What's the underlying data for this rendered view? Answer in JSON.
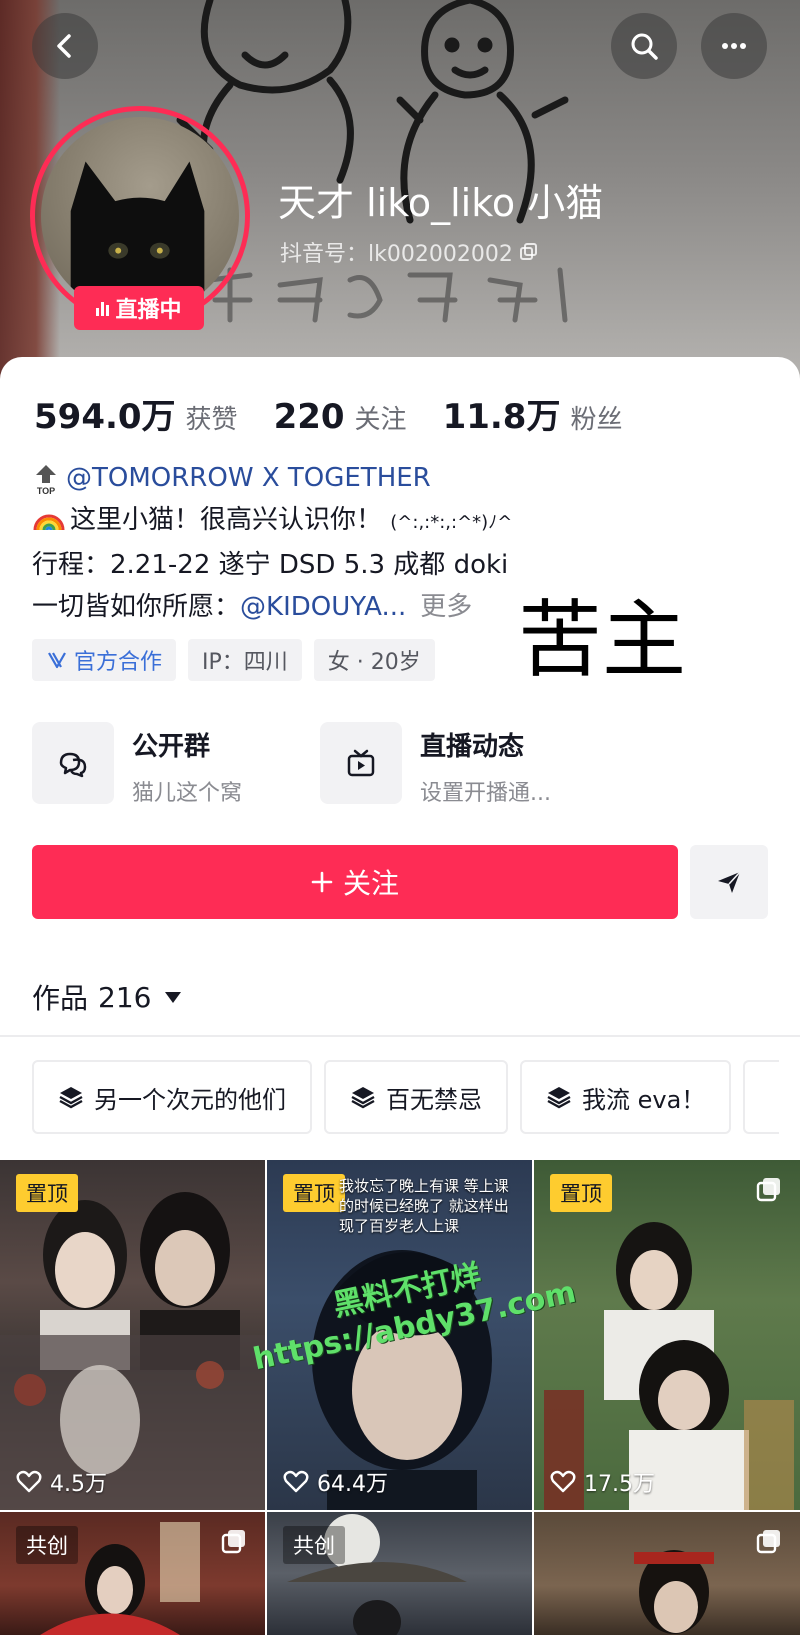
{
  "profile": {
    "nickname": "天才 liko_liko 小猫",
    "douyin_id": "抖音号：lk002002002",
    "live_badge": "直播中"
  },
  "stats": [
    {
      "value": "594.0万",
      "label": "获赞"
    },
    {
      "value": "220",
      "label": "关注"
    },
    {
      "value": "11.8万",
      "label": "粉丝"
    }
  ],
  "bio": {
    "top_link": "@TOMORROW X TOGETHER",
    "line2": "这里小猫！很高兴认识你！",
    "line2_kaomoji": "(^:,:*:,:^*)ﾉ^",
    "line3": "行程：2.21-22 遂宁 DSD 5.3 成都 doki",
    "line4_prefix": "一切皆如你所愿：",
    "line4_link": "@KIDOUYA...",
    "more": "更多"
  },
  "overlay_text": "苦主",
  "tags": [
    {
      "label": "官方合作",
      "icon": "official-icon"
    },
    {
      "label": "IP：四川"
    },
    {
      "label": "女 · 20岁"
    }
  ],
  "entries": [
    {
      "title": "公开群",
      "sub": "猫儿这个窝",
      "icon": "chat-group-icon"
    },
    {
      "title": "直播动态",
      "sub": "设置开播通...",
      "icon": "tv-icon"
    }
  ],
  "actions": {
    "follow": "关注",
    "share_icon": "send-icon"
  },
  "works": {
    "label": "作品",
    "count": "216"
  },
  "collections": [
    {
      "label": "另一个次元的他们"
    },
    {
      "label": "百无禁忌"
    },
    {
      "label": "我流 eva！"
    }
  ],
  "videos": [
    {
      "badge": "置顶",
      "likes": "4.5万"
    },
    {
      "badge": "置顶",
      "likes": "64.4万",
      "caption": "我妆忘了晚上有课 等上课的时候已经晚了 就这样出现了百岁老人上课"
    },
    {
      "badge": "置顶",
      "likes": "17.5万"
    },
    {
      "badge": "共创"
    },
    {
      "badge": "共创"
    },
    {
      "badge": ""
    }
  ],
  "watermark": {
    "line1": "黑料不打烊",
    "line2": "https://abdy37.com"
  },
  "colors": {
    "accent": "#fe2c55",
    "pin_badge": "#fecc2f",
    "link": "#2a4d9c"
  }
}
